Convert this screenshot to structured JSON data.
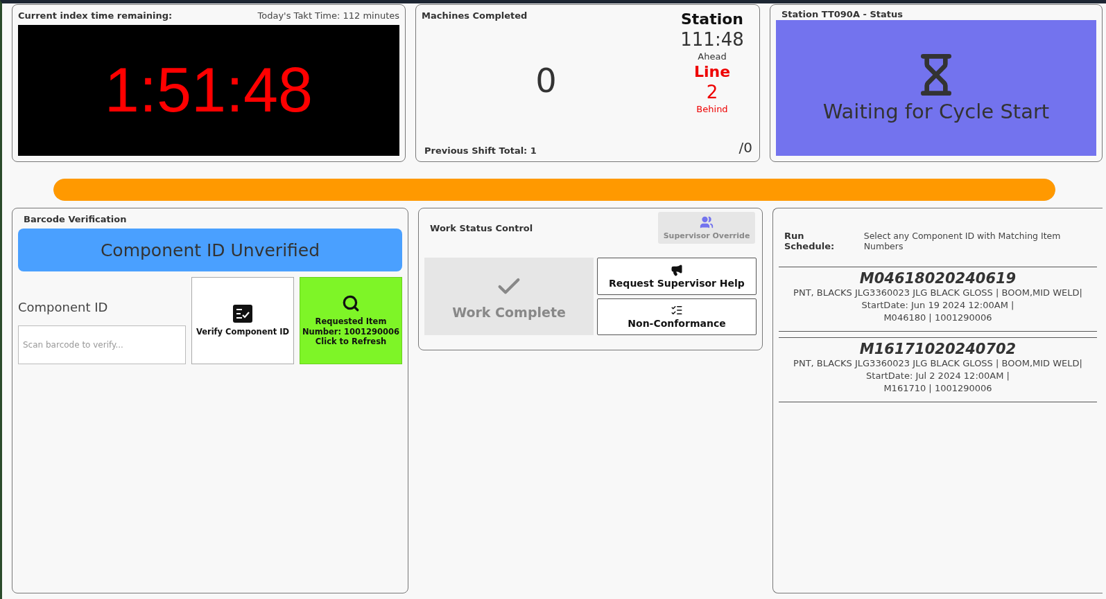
{
  "timer": {
    "title": "Current index time remaining:",
    "takt": "Today's Takt Time: 112 minutes",
    "time": "1:51:48"
  },
  "machines": {
    "title": "Machines Completed",
    "count": "0",
    "previous": "Previous Shift Total: 1",
    "total": "/0",
    "groups": [
      {
        "kind": "ahead",
        "heading": "Station",
        "value": "111:48",
        "label": "Ahead"
      },
      {
        "kind": "behind",
        "heading": "Line",
        "value": "2",
        "label": "Behind"
      }
    ]
  },
  "status": {
    "title": "Station TT090A - Status",
    "kind": "waiting",
    "message": "Waiting for Cycle Start"
  },
  "progress": {
    "level": 1
  },
  "barcode": {
    "title": "Barcode Verification",
    "verified": false,
    "banner": "Component ID Unverified",
    "field_label": "Component ID",
    "placeholder": "Scan barcode to verify...",
    "verify_button": "Verify Component ID",
    "refresh_button": [
      "Requested Item",
      "Number: 1001290006",
      "Click to Refresh"
    ]
  },
  "work": {
    "title": "Work Status Control",
    "override": {
      "label": "Supervisor Override",
      "disabled": true
    },
    "complete": {
      "label": "Work Complete",
      "disabled": true
    },
    "help": "Request Supervisor Help",
    "nonconformance": "Non-Conformance"
  },
  "schedule": {
    "title": "Run Schedule:",
    "hint": "Select any Component ID with Matching Item Numbers",
    "items": [
      {
        "id": "M04618020240619",
        "lines": [
          "PNT, BLACKS JLG3360023 JLG BLACK GLOSS | BOOM,MID WELD|",
          "StartDate: Jun 19 2024 12:00AM |",
          "M046180 | 1001290006"
        ]
      },
      {
        "id": "M16171020240702",
        "lines": [
          "PNT, BLACKS JLG3360023 JLG BLACK GLOSS | BOOM,MID WELD|",
          "StartDate: Jul 2 2024 12:00AM |",
          "M161710 | 1001290006"
        ]
      }
    ]
  }
}
